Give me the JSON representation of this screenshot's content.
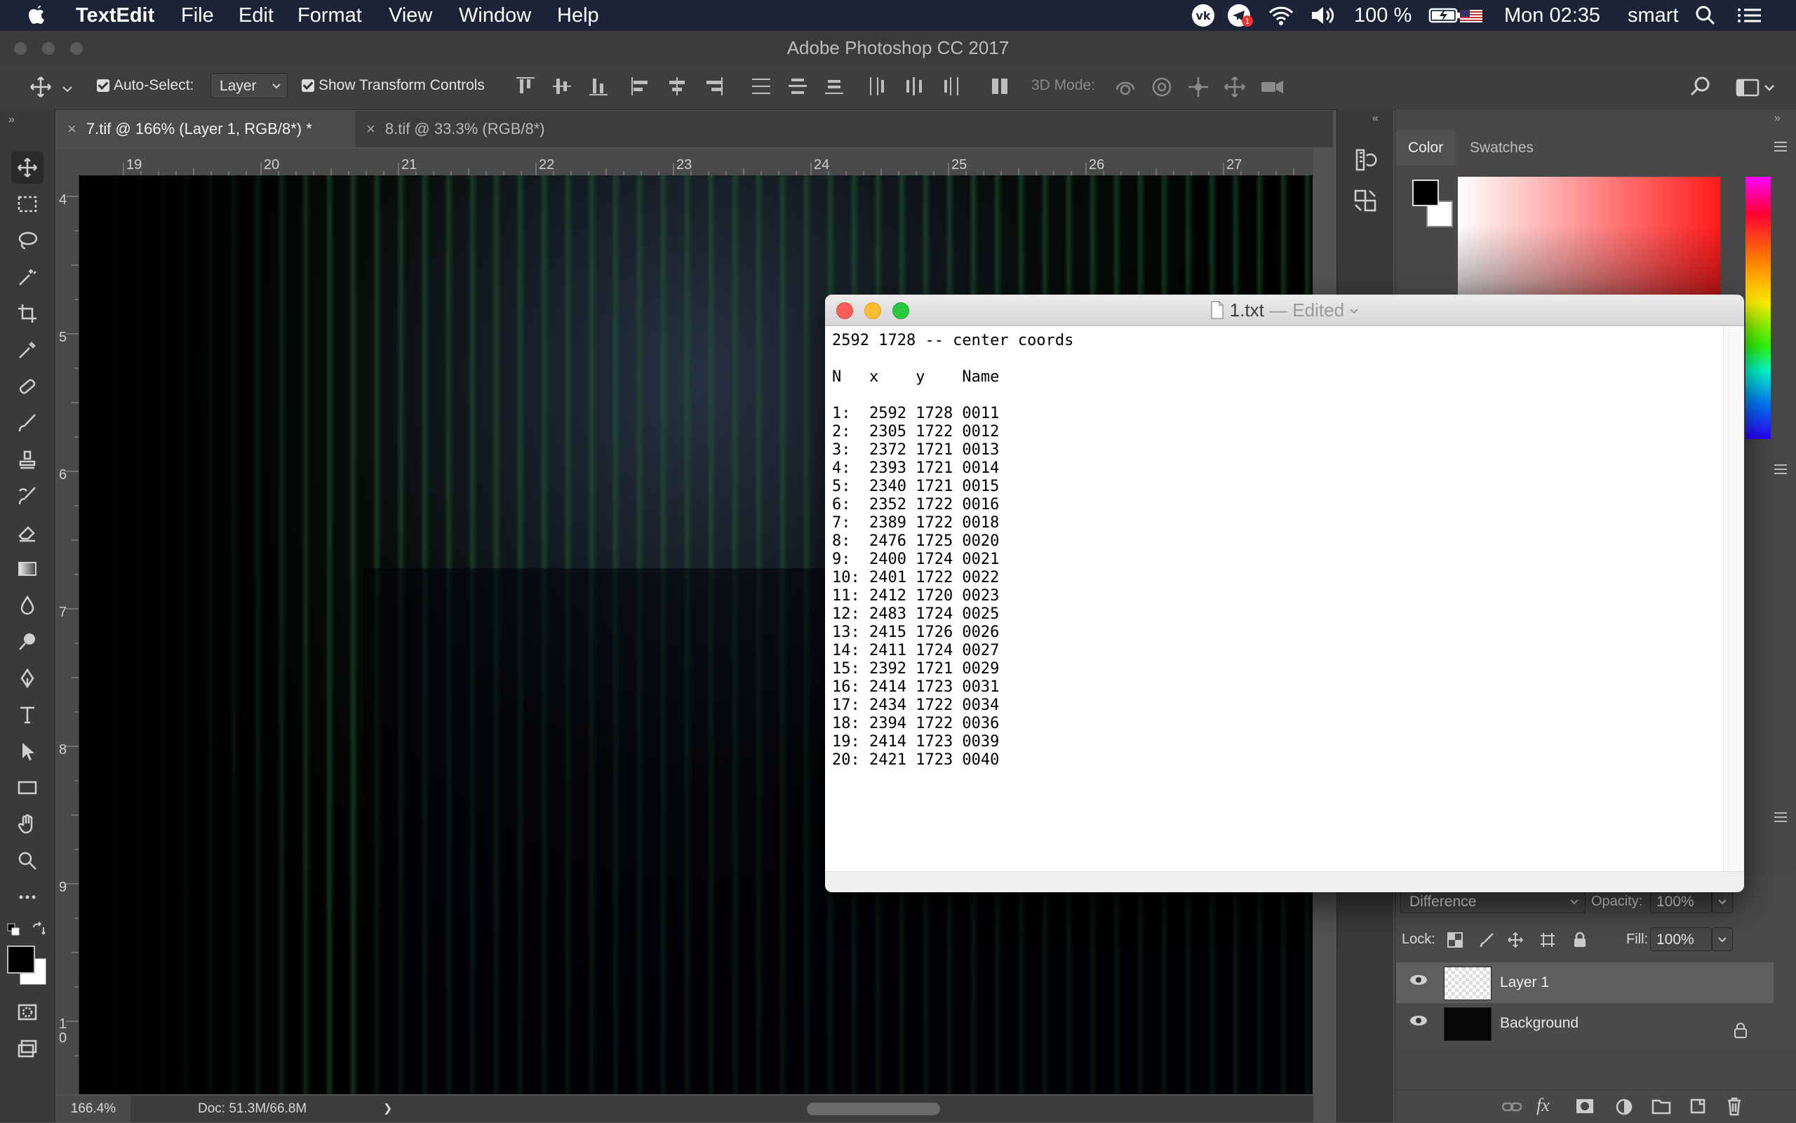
{
  "menubar": {
    "app_name": "TextEdit",
    "items": [
      "File",
      "Edit",
      "Format",
      "View",
      "Window",
      "Help"
    ],
    "battery": "100 %",
    "clock": "Mon 02:35",
    "user": "smart"
  },
  "photoshop": {
    "window_title": "Adobe Photoshop CC 2017",
    "options": {
      "auto_select_label": "Auto-Select:",
      "auto_select_value": "Layer",
      "show_transform_label": "Show Transform Controls",
      "mode_3d_label": "3D Mode:"
    },
    "tabs": [
      {
        "label": "7.tif @ 166% (Layer 1, RGB/8*) *",
        "active": true
      },
      {
        "label": "8.tif @ 33.3% (RGB/8*)",
        "active": false
      }
    ],
    "ruler_top": [
      "19",
      "20",
      "21",
      "22",
      "23",
      "24",
      "25",
      "26",
      "27"
    ],
    "ruler_left": [
      "4",
      "5",
      "6",
      "7",
      "8",
      "9",
      "1\n0"
    ],
    "status": {
      "zoom": "166.4%",
      "doc": "Doc: 51.3M/66.8M",
      "arrow": "❯"
    },
    "panels": {
      "color_tab": "Color",
      "swatches_tab": "Swatches",
      "colors": {
        "foreground": "#000000",
        "background": "#ffffff"
      }
    },
    "layers": {
      "blend_mode": "Difference",
      "opacity_label": "Opacity:",
      "opacity_value": "100%",
      "lock_label": "Lock:",
      "fill_label": "Fill:",
      "fill_value": "100%",
      "items": [
        {
          "name": "Layer 1",
          "selected": true
        },
        {
          "name": "Background",
          "selected": false,
          "locked": true
        }
      ]
    }
  },
  "textedit": {
    "filename": "1.txt",
    "edited": "— Edited",
    "content": "2592 1728 -- center coords\n\nN   x    y    Name\n\n1:  2592 1728 0011\n2:  2305 1722 0012\n3:  2372 1721 0013\n4:  2393 1721 0014\n5:  2340 1721 0015\n6:  2352 1722 0016\n7:  2389 1722 0018\n8:  2476 1725 0020\n9:  2400 1724 0021\n10: 2401 1722 0022\n11: 2412 1720 0023\n12: 2483 1724 0025\n13: 2415 1726 0026\n14: 2411 1724 0027\n15: 2392 1721 0029\n16: 2414 1723 0031\n17: 2434 1722 0034\n18: 2394 1722 0036\n19: 2414 1723 0039\n20: 2421 1723 0040"
  }
}
